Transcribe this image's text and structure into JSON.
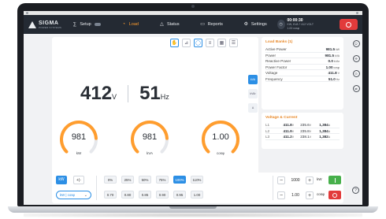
{
  "brand": {
    "name": "SIGMA",
    "subtitle": "POWER SYSTEMS"
  },
  "nav": {
    "items": [
      {
        "label": "Setup",
        "icon": "sliders-icon"
      },
      {
        "label": "Load",
        "icon": "load-icon",
        "active": true
      },
      {
        "label": "Status",
        "icon": "warning-icon"
      },
      {
        "label": "Reports",
        "icon": "reports-icon"
      },
      {
        "label": "Settings",
        "icon": "gear-icon"
      }
    ],
    "clock_time": "00:00:30",
    "clock_sub": "KW, KVA ? 412 VOLT  1.00 cosφ"
  },
  "readout": {
    "voltage_value": "412",
    "voltage_unit": "V",
    "frequency_value": "51",
    "frequency_unit": "Hz"
  },
  "side_buttons": [
    "kVA",
    "kVAr",
    "A"
  ],
  "gauges": [
    {
      "value": "981",
      "unit": "kW",
      "fraction": 0.82
    },
    {
      "value": "981",
      "unit": "kVA",
      "fraction": 0.82
    },
    {
      "value": "1.00",
      "unit": "cosφ",
      "fraction": 1.0
    }
  ],
  "load_banks": {
    "title": "Load Banks (1)",
    "rows": [
      {
        "label": "Active Power",
        "value": "981.5",
        "unit": "kW"
      },
      {
        "label": "Power",
        "value": "981.5",
        "unit": "kVA"
      },
      {
        "label": "Reactive Power",
        "value": "0.0",
        "unit": "kVAr"
      },
      {
        "label": "Power Factor",
        "value": "1.00",
        "unit": "cosφ"
      },
      {
        "label": "Voltage",
        "value": "411.8",
        "unit": "V"
      },
      {
        "label": "Frequency",
        "value": "51.0",
        "unit": "Hz"
      }
    ]
  },
  "voltage_current": {
    "title": "Voltage & Current",
    "rows": [
      {
        "phase": "L1",
        "v_ll": "411.8",
        "v_ln": "235.6",
        "current": "1,384"
      },
      {
        "phase": "L2",
        "v_ll": "411.9",
        "v_ln": "235.8",
        "current": "1,384"
      },
      {
        "phase": "L3",
        "v_ll": "411.2",
        "v_ln": "238.1",
        "current": "1,382"
      }
    ],
    "unit_v": "V",
    "unit_a": "A"
  },
  "controls": {
    "mode_active": "kW",
    "mode_idle": "+|-",
    "select_label": "kW | cosφ",
    "percent_buttons": [
      "0%",
      "25%",
      "50%",
      "75%",
      "100%",
      "110%"
    ],
    "percent_active_index": 4,
    "cos_buttons": [
      "0.70",
      "0.80",
      "0.85",
      "0.90",
      "0.95",
      "1.00"
    ],
    "kw_stepper": {
      "value": "1000",
      "unit": "kW"
    },
    "cos_stepper": {
      "value": "1.00",
      "unit": "cosφ"
    }
  },
  "colors": {
    "accent": "#2c8fe5",
    "orange": "#ff9d2e",
    "danger": "#e23b3b",
    "ok": "#47b04b",
    "nav_bg": "#242a33"
  }
}
